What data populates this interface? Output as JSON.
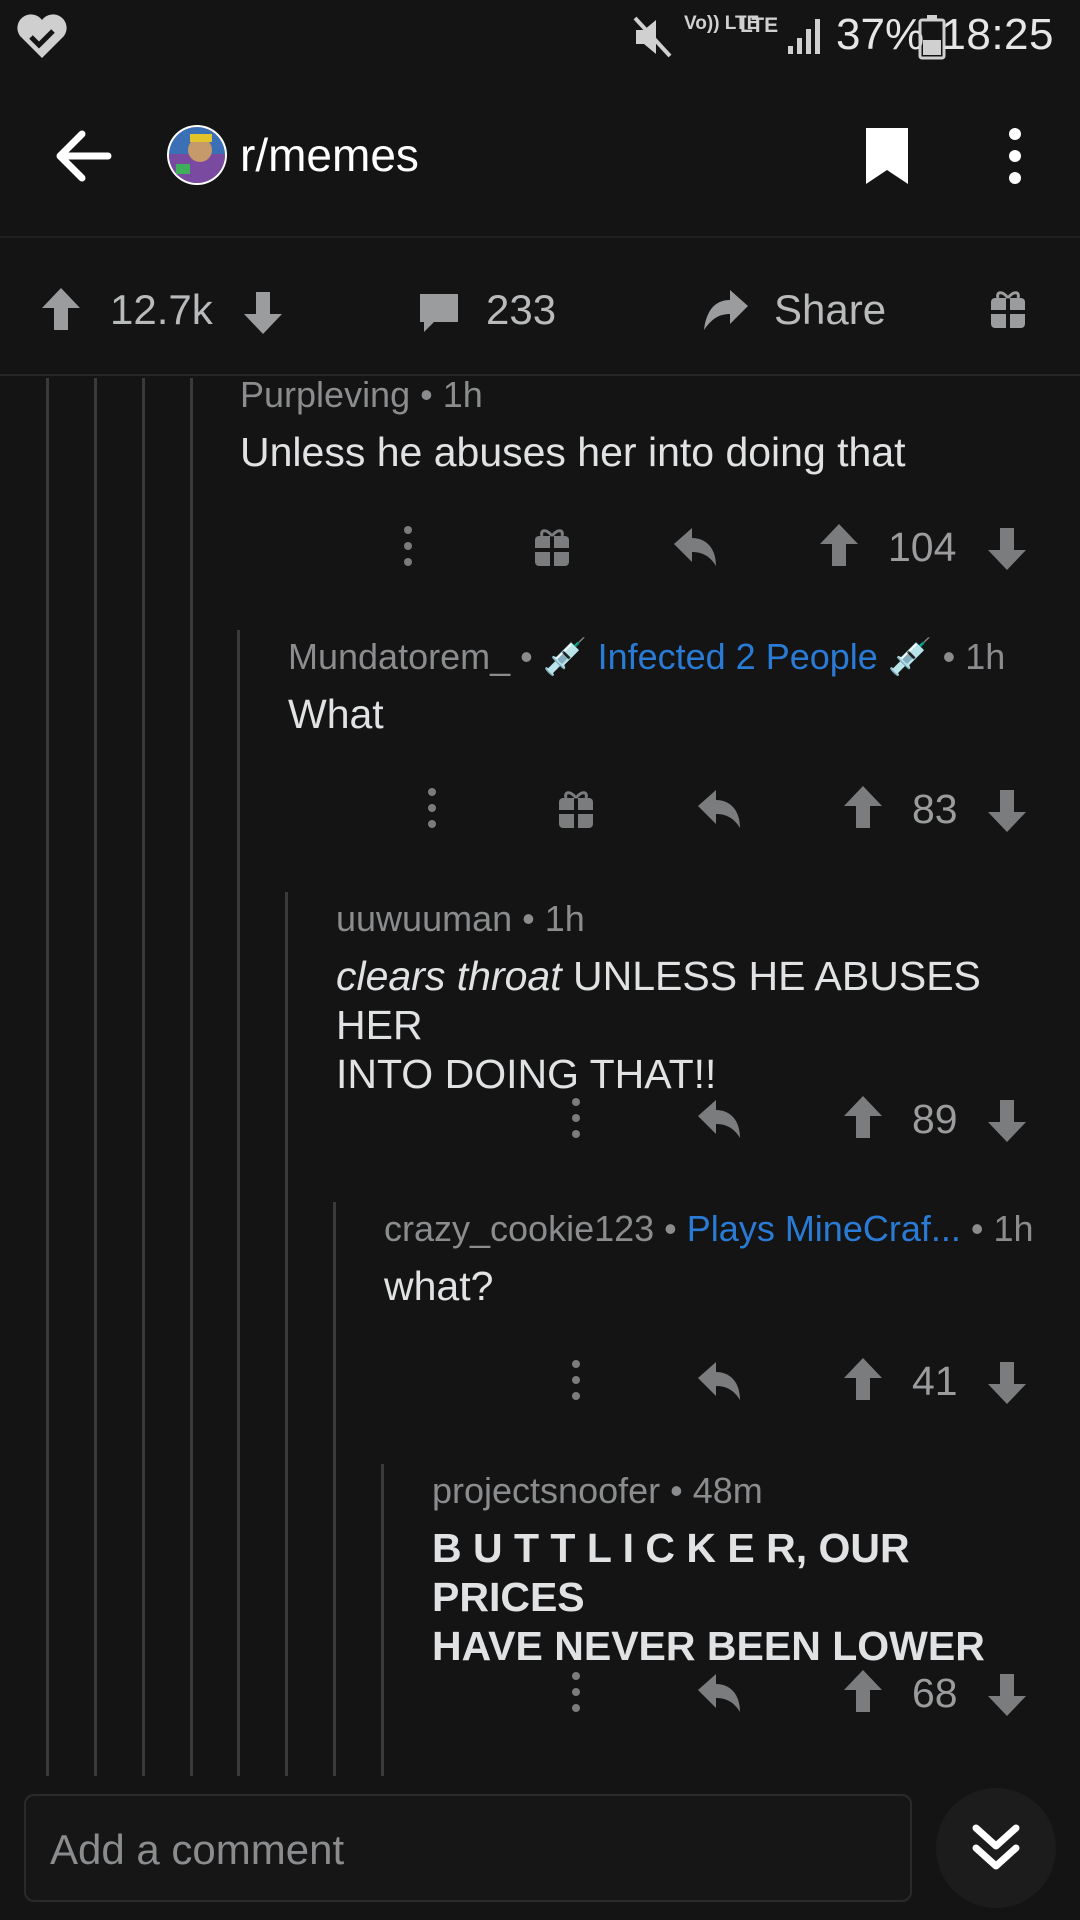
{
  "status_bar": {
    "time": "18:25",
    "battery": "37%",
    "network": "LTE",
    "volte": "Vo)) LTE"
  },
  "header": {
    "subreddit": "r/memes",
    "icons": [
      "back-arrow-icon",
      "subreddit-avatar",
      "bookmark-icon",
      "more-vertical-icon"
    ]
  },
  "post_actions": {
    "score": "12.7k",
    "comments": "233",
    "share": "Share"
  },
  "comments": [
    {
      "author": "Purpleving",
      "time": "1h",
      "body": "Unless he abuses her into doing that",
      "score": "104"
    },
    {
      "author": "Mundatorem_",
      "flair": "Infected 2 People",
      "time": "1h",
      "body": "What",
      "score": "83"
    },
    {
      "author": "uuwuuman",
      "time": "1h",
      "body_italic": "clears throat",
      "body": "UNLESS HE ABUSES HER",
      "body_line2": "INTO DOING THAT!!",
      "score": "89"
    },
    {
      "author": "crazy_cookie123",
      "flair": "Plays MineCraf...",
      "time": "1h",
      "body": "what?",
      "score": "41"
    },
    {
      "author": "projectsnoofer",
      "time": "48m",
      "body": "B U T T L I C K E R, OUR PRICES",
      "body_line2": "HAVE NEVER BEEN LOWER",
      "score": "68"
    }
  ],
  "comment_bar": {
    "placeholder": "Add a comment"
  },
  "colors": {
    "background": "#141414",
    "flair": "#2a7bd6",
    "thread_line": "#3a3a3a"
  }
}
